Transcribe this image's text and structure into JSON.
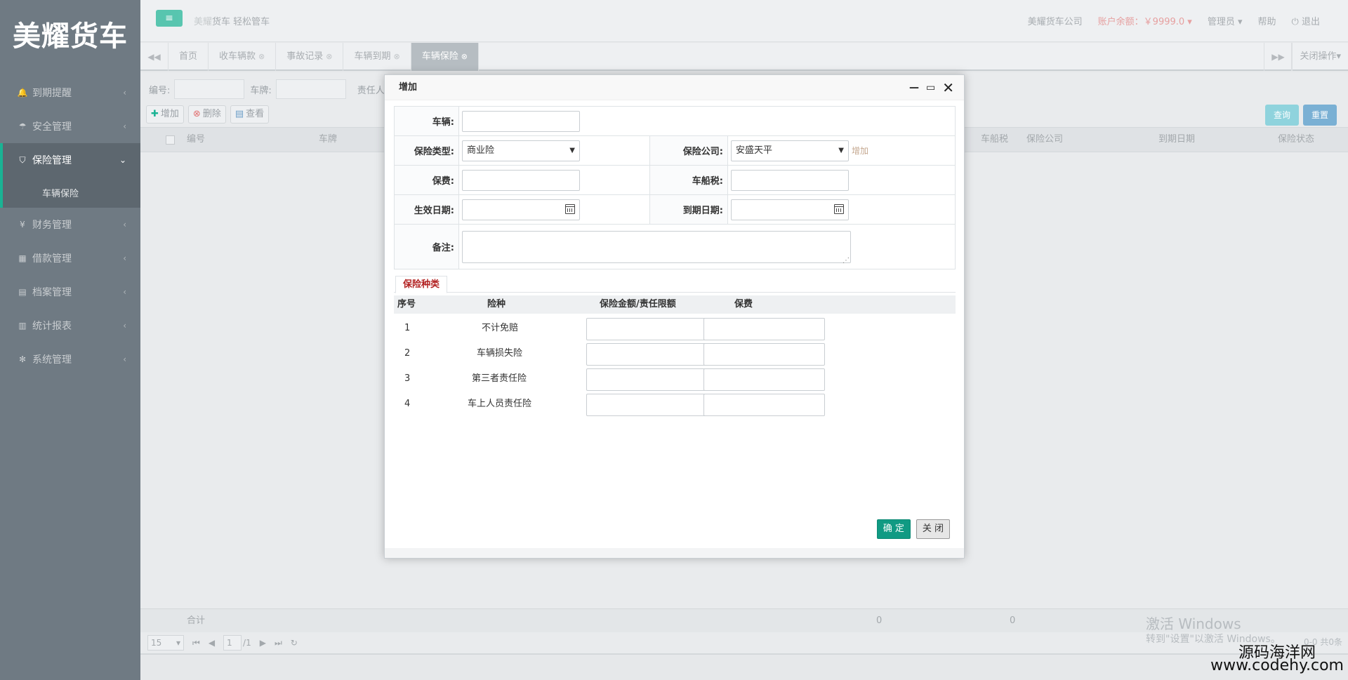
{
  "app": {
    "logo": "美耀货车",
    "slogan_brand": "美耀",
    "slogan_rest": "货车 轻松管车"
  },
  "header": {
    "company": "美耀货车公司",
    "balance": "账户余额：￥9999.0",
    "user": "管理员",
    "help": "帮助",
    "logout": "退出"
  },
  "sidebar": {
    "items": [
      {
        "label": "到期提醒",
        "icon": "bell-icon",
        "glyph": "🔔"
      },
      {
        "label": "安全管理",
        "icon": "umbrella-icon",
        "glyph": "☂"
      },
      {
        "label": "保险管理",
        "icon": "shield-icon",
        "glyph": "⛉"
      },
      {
        "label": "财务管理",
        "icon": "yen-icon",
        "glyph": "¥"
      },
      {
        "label": "借款管理",
        "icon": "calculator-icon",
        "glyph": "▦"
      },
      {
        "label": "档案管理",
        "icon": "file-icon",
        "glyph": "▤"
      },
      {
        "label": "统计报表",
        "icon": "bar-chart-icon",
        "glyph": "▥"
      },
      {
        "label": "系统管理",
        "icon": "gear-icon",
        "glyph": "✻"
      }
    ],
    "submenu": "车辆保险"
  },
  "tabs": {
    "items": [
      "首页",
      "收车辆款",
      "事故记录",
      "车辆到期",
      "车辆保险"
    ],
    "close_ops": "关闭操作"
  },
  "search": {
    "code_label": "编号:",
    "plate_label": "车牌:",
    "person_label": "责任人:"
  },
  "toolbar": {
    "add": "增加",
    "delete": "删除",
    "view": "查看",
    "query": "查询",
    "reset": "重置"
  },
  "grid": {
    "columns": [
      "编号",
      "车牌",
      "车船税",
      "保险公司",
      "到期日期",
      "保险状态"
    ],
    "footer_label": "合计",
    "footer_values": [
      "0",
      "0"
    ]
  },
  "pager": {
    "page_size": "15",
    "page": "1",
    "total_pages": "/1",
    "info": "0-0 共0条"
  },
  "modal": {
    "title": "增加",
    "vehicle_label": "车辆:",
    "ins_type_label": "保险类型:",
    "ins_type_value": "商业险",
    "company_label": "保险公司:",
    "company_value": "安盛天平",
    "add_link": "增加",
    "premium_label": "保费:",
    "tax_label": "车船税:",
    "start_label": "生效日期:",
    "end_label": "到期日期:",
    "remark_label": "备注:",
    "tab_label": "保险种类",
    "table_headers": [
      "序号",
      "险种",
      "保险金额/责任限额",
      "保费"
    ],
    "rows": [
      {
        "no": "1",
        "kind": "不计免赔"
      },
      {
        "no": "2",
        "kind": "车辆损失险"
      },
      {
        "no": "3",
        "kind": "第三者责任险"
      },
      {
        "no": "4",
        "kind": "车上人员责任险"
      }
    ],
    "ok": "确 定",
    "close": "关 闭"
  },
  "watermark": {
    "activate": "激活 Windows",
    "activate_sub": "转到\"设置\"以激活 Windows。",
    "site_name": "源码海洋网",
    "site_url": "www.codehy.com"
  }
}
